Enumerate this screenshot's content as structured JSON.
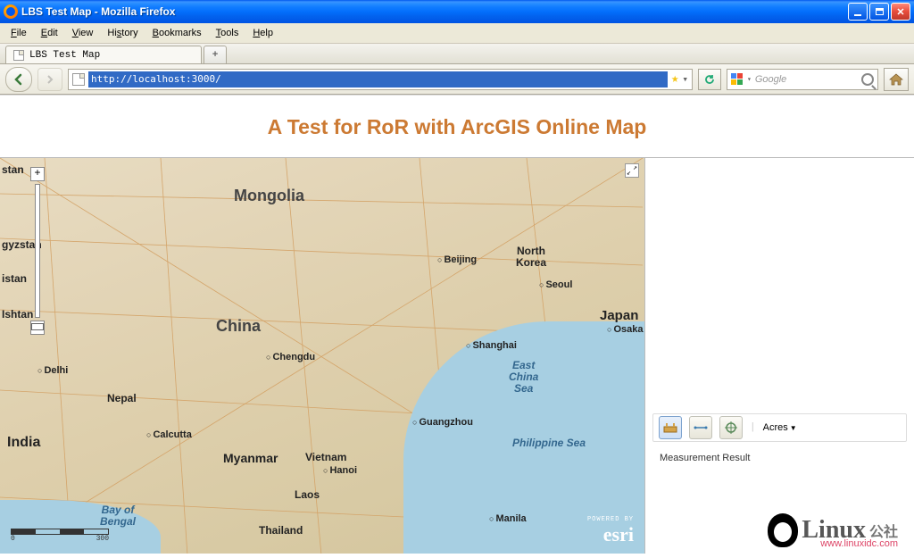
{
  "window": {
    "title": "LBS Test Map - Mozilla Firefox"
  },
  "menu": {
    "file": "File",
    "edit": "Edit",
    "view": "View",
    "history": "History",
    "bookmarks": "Bookmarks",
    "tools": "Tools",
    "help": "Help"
  },
  "tab": {
    "title": "LBS Test Map",
    "newtab": "+"
  },
  "nav": {
    "url": "http://localhost:3000/",
    "search_placeholder": "Google",
    "star_title": "Bookmark",
    "reload_title": "Reload"
  },
  "page": {
    "heading": "A Test for RoR with ArcGIS Online Map"
  },
  "map": {
    "expand_title": "Full extent",
    "scale": {
      "t1": "0",
      "t2": "300"
    },
    "attribution": {
      "powered": "POWERED BY",
      "logo": "esri"
    },
    "countries": {
      "mongolia": "Mongolia",
      "china": "China",
      "india": "India",
      "nepal": "Nepal",
      "myanmar": "Myanmar",
      "vietnam": "Vietnam",
      "laos": "Laos",
      "thailand": "Thailand",
      "nkorea": "North\nKorea",
      "japan": "Japan",
      "kazakhstan": "stan",
      "kyrgyzstan": "gyzstan",
      "tajikistan": "istan",
      "ishtan": "Ishtan"
    },
    "cities": {
      "beijing": "Beijing",
      "shanghai": "Shanghai",
      "chengdu": "Chengdu",
      "guangzhou": "Guangzhou",
      "delhi": "Delhi",
      "calcutta": "Calcutta",
      "hanoi": "Hanoi",
      "seoul": "Seoul",
      "osaka": "Osaka",
      "manila": "Manila"
    },
    "seas": {
      "eastchina": "East\nChina\nSea",
      "philippine": "Philippine Sea",
      "bengal": "Bay of\nBengal"
    }
  },
  "panel": {
    "area_title": "Area",
    "distance_title": "Distance",
    "location_title": "Location",
    "unit": "Acres",
    "result_label": "Measurement Result"
  },
  "watermark": {
    "text": "Linux",
    "cn": "公社",
    "url": "www.linuxidc.com"
  }
}
